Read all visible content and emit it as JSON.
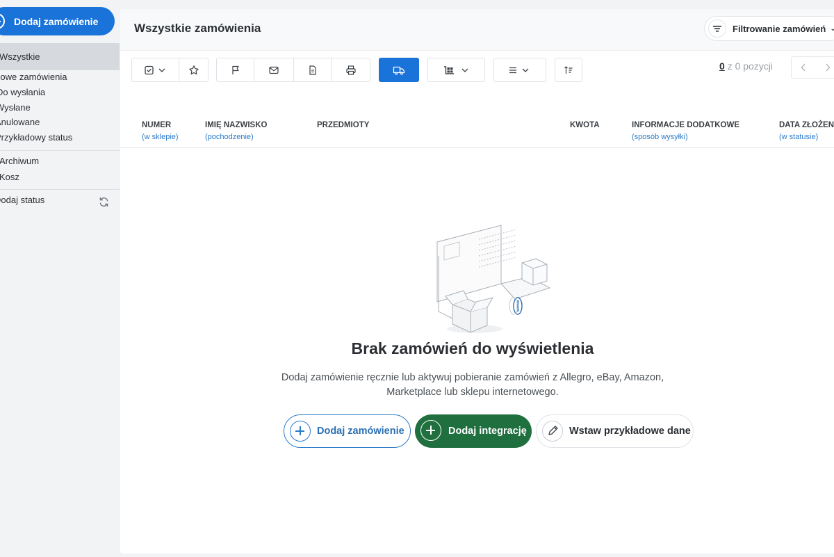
{
  "sidebar": {
    "add_order_label": "Dodaj zamówienie",
    "active_item": "Wszystkie",
    "status_items": [
      "Nowe zamówienia",
      "Do wysłania",
      "Wysłane",
      "Anulowane",
      "Przykładowy status"
    ],
    "archive_label": "Archiwum",
    "trash_label": "Kosz",
    "add_status_label": "Dodaj status"
  },
  "header": {
    "title": "Wszystkie zamówienia",
    "filter_label": "Filtrowanie zamówień"
  },
  "pagination": {
    "current": "0",
    "rest": "z 0 pozycji"
  },
  "table": {
    "columns": [
      {
        "label": "NUMER",
        "sub": "(w sklepie)"
      },
      {
        "label": "IMIĘ NAZWISKO",
        "sub": "(pochodzenie)"
      },
      {
        "label": "PRZEDMIOTY",
        "sub": ""
      },
      {
        "label": "KWOTA",
        "sub": ""
      },
      {
        "label": "INFORMACJE DODATKOWE",
        "sub": "(sposób wysyłki)"
      },
      {
        "label": "DATA ZŁOŻENIA",
        "sub": "(w statusie)"
      }
    ]
  },
  "empty_state": {
    "title": "Brak zamówień do wyświetlenia",
    "description": "Dodaj zamówienie ręcznie lub aktywuj pobieranie zamówień z Allegro, eBay, Amazon, Marketplace lub sklepu internetowego.",
    "add_order_label": "Dodaj zamówienie",
    "add_integration_label": "Dodaj integrację",
    "sample_data_label": "Wstaw przykładowe dane"
  },
  "colors": {
    "primary": "#1a73d9",
    "green": "#1f6f3f",
    "link": "#2a7bc9"
  }
}
